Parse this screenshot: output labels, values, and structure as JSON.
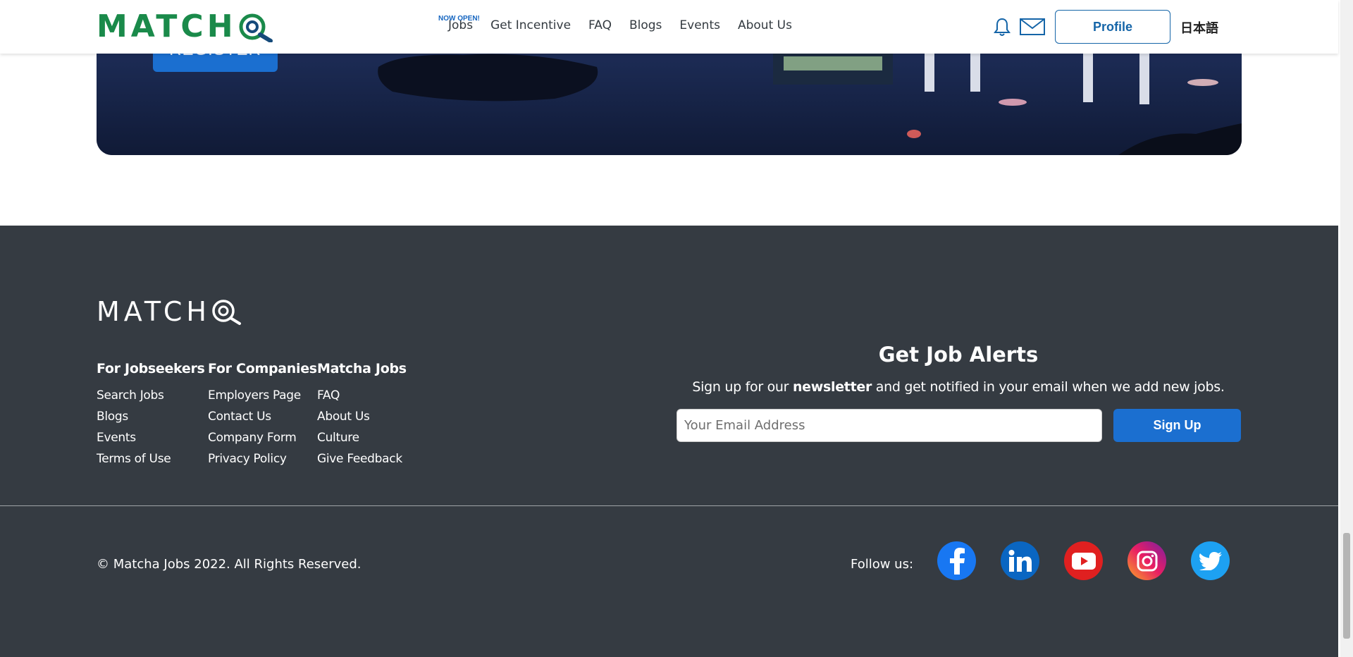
{
  "header": {
    "logo_text": "MATCH",
    "nav": [
      {
        "label": "Jobs",
        "badge": "NOW OPEN!"
      },
      {
        "label": "Get Incentive"
      },
      {
        "label": "FAQ"
      },
      {
        "label": "Blogs"
      },
      {
        "label": "Events"
      },
      {
        "label": "About Us"
      }
    ],
    "profile_label": "Profile",
    "language_label": "日本語",
    "icons": [
      "bell-icon",
      "mail-icon"
    ]
  },
  "hero": {
    "register_label": "REGISTER"
  },
  "footer": {
    "logo_text": "MATCH",
    "columns": [
      {
        "title": "For Jobseekers",
        "links": [
          "Search Jobs",
          "Blogs",
          "Events",
          "Terms of Use"
        ]
      },
      {
        "title": "For Companies",
        "links": [
          "Employers Page",
          "Contact Us",
          "Company Form",
          "Privacy Policy"
        ]
      },
      {
        "title": "Matcha Jobs",
        "links": [
          "FAQ",
          "About Us",
          "Culture",
          "Give Feedback"
        ]
      }
    ],
    "alerts": {
      "title": "Get Job Alerts",
      "subtitle_before": "Sign up for our ",
      "subtitle_bold": "newsletter",
      "subtitle_after": " and get notified in your email when we add new jobs.",
      "email_placeholder": "Your Email Address",
      "signup_label": "Sign Up"
    },
    "copyright": "© Matcha Jobs 2022. All Rights Reserved.",
    "follow_label": "Follow us:",
    "social": [
      {
        "name": "facebook-icon",
        "color": "#1877f2"
      },
      {
        "name": "linkedin-icon",
        "color": "#0a66c2"
      },
      {
        "name": "youtube-icon",
        "color": "#e02020"
      },
      {
        "name": "instagram-icon",
        "color": "#d6249f"
      },
      {
        "name": "twitter-icon",
        "color": "#1da1f2"
      }
    ]
  },
  "colors": {
    "brand_green": "#1a8a4a",
    "brand_blue": "#1565a8",
    "button_blue": "#1b6fd0",
    "footer_bg": "#353b42"
  }
}
